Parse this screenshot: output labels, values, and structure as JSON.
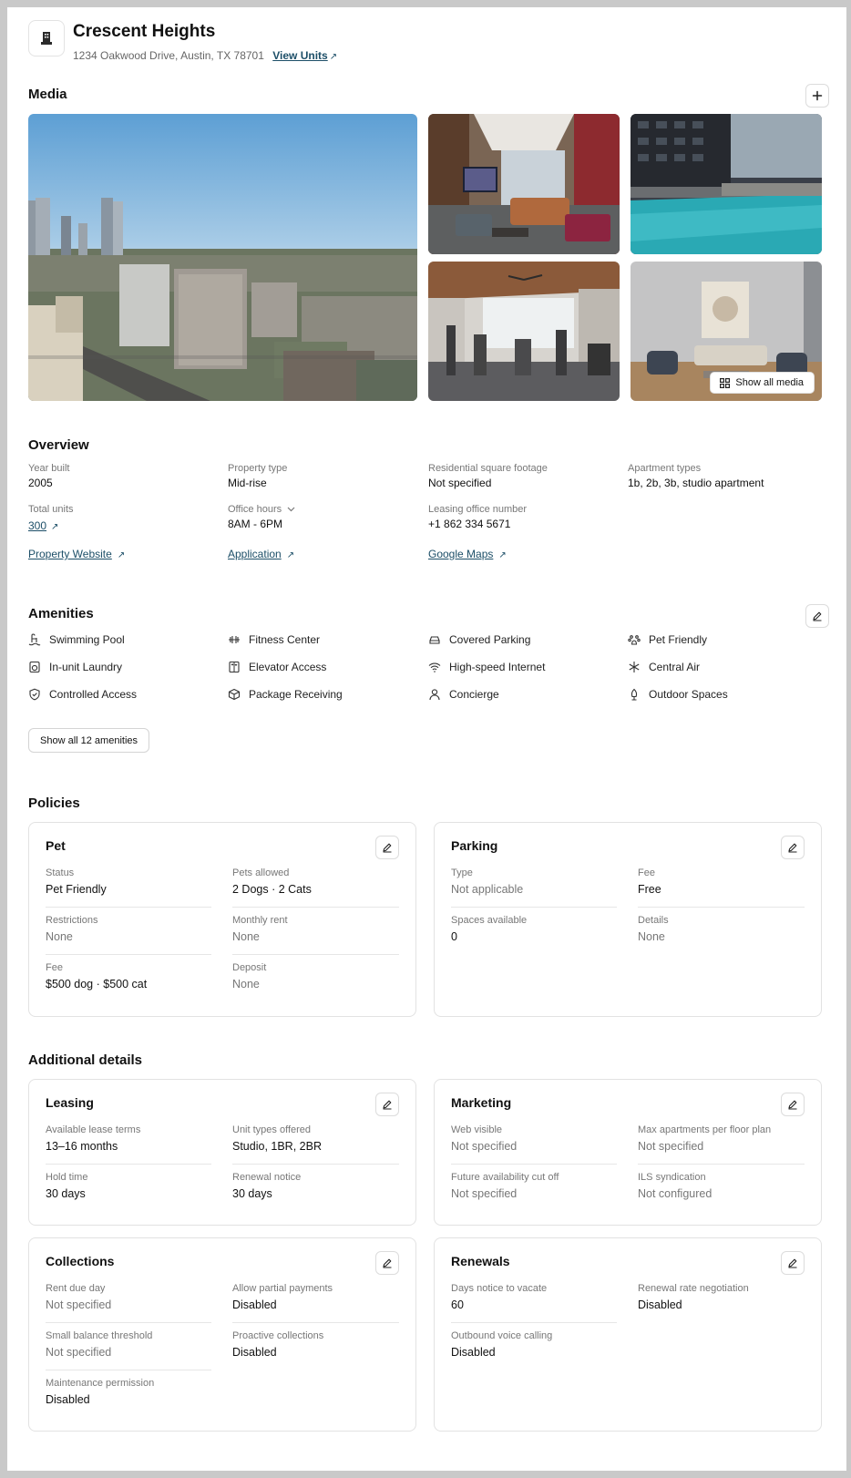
{
  "property": {
    "name": "Crescent Heights",
    "address": "1234 Oakwood Drive, Austin, TX 78701",
    "view_units_label": "View Units"
  },
  "media": {
    "title": "Media",
    "add_icon": "plus-icon",
    "show_all_label": "Show all media",
    "photos": [
      "city-skyline-photo",
      "lounge-photo",
      "pool-photo",
      "gym-photo",
      "living-room-photo"
    ]
  },
  "overview": {
    "title": "Overview",
    "year_built_label": "Year built",
    "year_built": "2005",
    "property_type_label": "Property type",
    "property_type": "Mid-rise",
    "sqft_label": "Residential square footage",
    "sqft": "Not specified",
    "apt_types_label": "Apartment types",
    "apt_types": "1b, 2b, 3b, studio apartment",
    "total_units_label": "Total units",
    "total_units": "300",
    "office_hours_label": "Office hours",
    "office_hours": "8AM - 6PM",
    "phone_label": "Leasing office number",
    "phone": "+1 862 334 5671",
    "links": {
      "website": "Property Website",
      "application": "Application",
      "maps": "Google Maps"
    }
  },
  "amenities": {
    "title": "Amenities",
    "items": [
      {
        "label": "Swimming Pool",
        "icon": "pool-icon"
      },
      {
        "label": "Fitness Center",
        "icon": "dumbbell-icon"
      },
      {
        "label": "Covered Parking",
        "icon": "car-icon"
      },
      {
        "label": "Pet Friendly",
        "icon": "paw-icon"
      },
      {
        "label": "In-unit Laundry",
        "icon": "washer-icon"
      },
      {
        "label": "Elevator Access",
        "icon": "elevator-icon"
      },
      {
        "label": "High-speed Internet",
        "icon": "wifi-icon"
      },
      {
        "label": "Central Air",
        "icon": "snowflake-icon"
      },
      {
        "label": "Controlled Access",
        "icon": "shield-icon"
      },
      {
        "label": "Package Receiving",
        "icon": "package-icon"
      },
      {
        "label": "Concierge",
        "icon": "person-icon"
      },
      {
        "label": "Outdoor Spaces",
        "icon": "tree-icon"
      }
    ],
    "show_all_label": "Show all 12 amenities"
  },
  "policies": {
    "title": "Policies",
    "pet": {
      "title": "Pet",
      "status_label": "Status",
      "status": "Pet Friendly",
      "allowed_label": "Pets allowed",
      "allowed": "2 Dogs · 2 Cats",
      "restrictions_label": "Restrictions",
      "restrictions": "None",
      "monthly_rent_label": "Monthly rent",
      "monthly_rent": "None",
      "fee_label": "Fee",
      "fee": "$500 dog · $500 cat",
      "deposit_label": "Deposit",
      "deposit": "None"
    },
    "parking": {
      "title": "Parking",
      "type_label": "Type",
      "type": "Not applicable",
      "fee_label": "Fee",
      "fee": "Free",
      "spaces_label": "Spaces available",
      "spaces": "0",
      "details_label": "Details",
      "details": "None"
    }
  },
  "additional": {
    "title": "Additional details",
    "leasing": {
      "title": "Leasing",
      "terms_label": "Available lease terms",
      "terms": "13–16 months",
      "unit_types_label": "Unit types offered",
      "unit_types": "Studio, 1BR, 2BR",
      "hold_label": "Hold time",
      "hold": "30 days",
      "renewal_label": "Renewal notice",
      "renewal": "30 days"
    },
    "marketing": {
      "title": "Marketing",
      "web_label": "Web visible",
      "web": "Not specified",
      "max_label": "Max apartments per floor plan",
      "max": "Not specified",
      "cutoff_label": "Future availability cut off",
      "cutoff": "Not specified",
      "ils_label": "ILS syndication",
      "ils": "Not configured"
    },
    "collections": {
      "title": "Collections",
      "due_label": "Rent due day",
      "due": "Not specified",
      "partial_label": "Allow partial payments",
      "partial": "Disabled",
      "threshold_label": "Small balance threshold",
      "threshold": "Not specified",
      "proactive_label": "Proactive collections",
      "proactive": "Disabled",
      "maint_label": "Maintenance permission",
      "maint": "Disabled"
    },
    "renewals": {
      "title": "Renewals",
      "notice_label": "Days notice to vacate",
      "notice": "60",
      "negotiation_label": "Renewal rate negotiation",
      "negotiation": "Disabled",
      "voice_label": "Outbound voice calling",
      "voice": "Disabled"
    }
  }
}
